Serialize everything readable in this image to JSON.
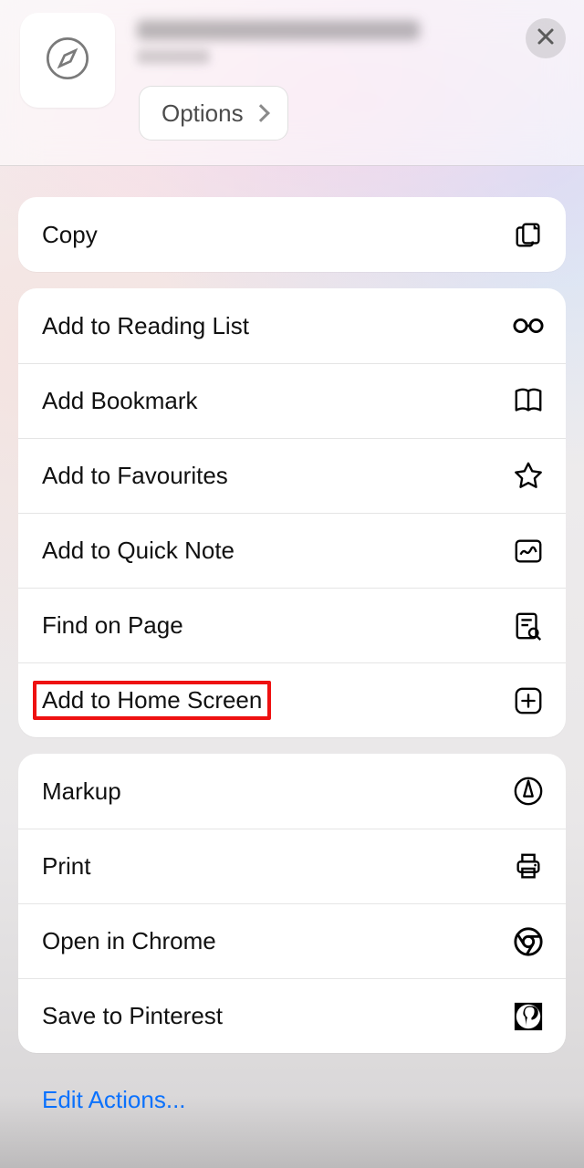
{
  "header": {
    "options_label": "Options"
  },
  "groups": [
    {
      "rows": [
        {
          "key": "copy",
          "label": "Copy",
          "icon": "copy-icon"
        }
      ]
    },
    {
      "rows": [
        {
          "key": "reading-list",
          "label": "Add to Reading List",
          "icon": "glasses-icon"
        },
        {
          "key": "bookmark",
          "label": "Add Bookmark",
          "icon": "book-icon"
        },
        {
          "key": "favourites",
          "label": "Add to Favourites",
          "icon": "star-icon"
        },
        {
          "key": "quick-note",
          "label": "Add to Quick Note",
          "icon": "quicknote-icon"
        },
        {
          "key": "find-on-page",
          "label": "Find on Page",
          "icon": "find-icon"
        },
        {
          "key": "home-screen",
          "label": "Add to Home Screen",
          "icon": "plus-square-icon",
          "highlighted": true
        }
      ]
    },
    {
      "rows": [
        {
          "key": "markup",
          "label": "Markup",
          "icon": "markup-icon"
        },
        {
          "key": "print",
          "label": "Print",
          "icon": "printer-icon"
        },
        {
          "key": "open-chrome",
          "label": "Open in Chrome",
          "icon": "chrome-icon"
        },
        {
          "key": "save-pinterest",
          "label": "Save to Pinterest",
          "icon": "pinterest-icon"
        }
      ]
    }
  ],
  "footer": {
    "edit_actions_label": "Edit Actions..."
  }
}
